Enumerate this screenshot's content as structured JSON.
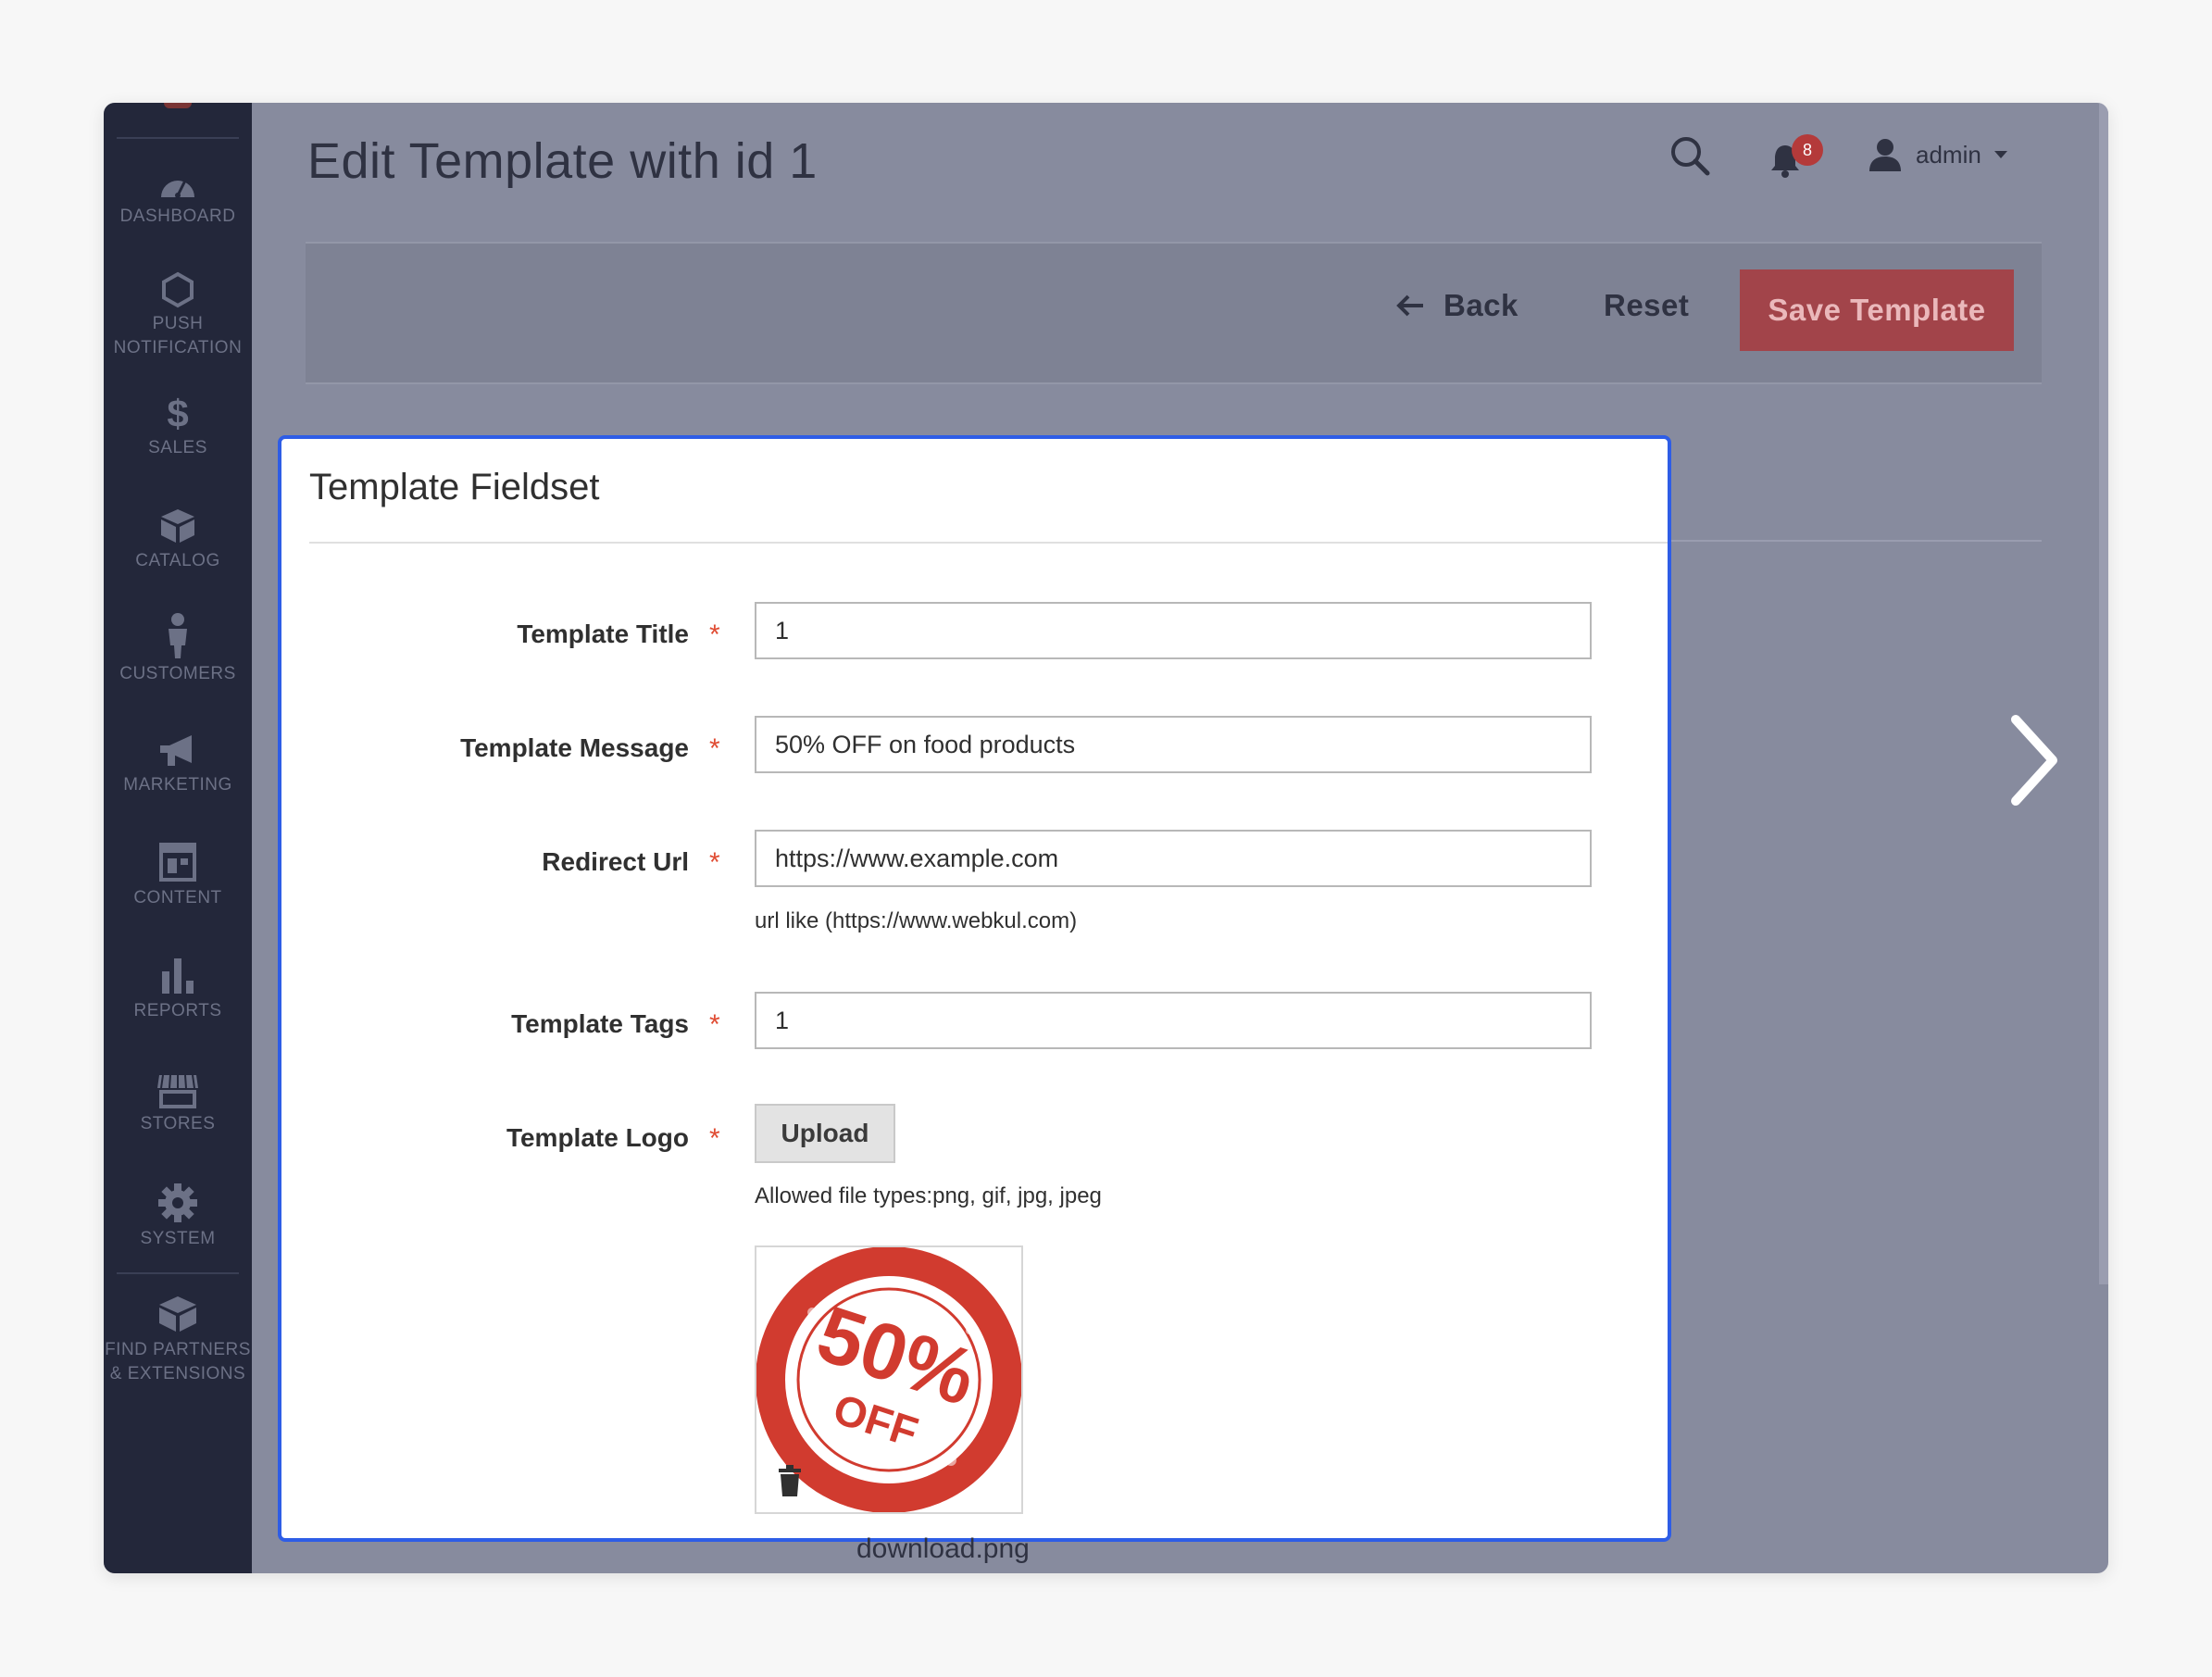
{
  "sidebar": {
    "items": [
      {
        "id": "dashboard",
        "label": "DASHBOARD",
        "icon": "dashboard-icon"
      },
      {
        "id": "push-notification",
        "label": "PUSH\nNOTIFICATION",
        "icon": "hexagon-icon"
      },
      {
        "id": "sales",
        "label": "SALES",
        "icon": "dollar-icon"
      },
      {
        "id": "catalog",
        "label": "CATALOG",
        "icon": "box-icon"
      },
      {
        "id": "customers",
        "label": "CUSTOMERS",
        "icon": "person-icon"
      },
      {
        "id": "marketing",
        "label": "MARKETING",
        "icon": "megaphone-icon"
      },
      {
        "id": "content",
        "label": "CONTENT",
        "icon": "layout-icon"
      },
      {
        "id": "reports",
        "label": "REPORTS",
        "icon": "bar-chart-icon"
      },
      {
        "id": "stores",
        "label": "STORES",
        "icon": "storefront-icon"
      },
      {
        "id": "system",
        "label": "SYSTEM",
        "icon": "gear-icon"
      },
      {
        "id": "find-partners",
        "label": "FIND PARTNERS\n& EXTENSIONS",
        "icon": "cubes-icon"
      }
    ]
  },
  "header": {
    "title": "Edit Template with id 1",
    "notifications_count": "8",
    "user_name": "admin"
  },
  "toolbar": {
    "back_label": "Back",
    "reset_label": "Reset",
    "save_label": "Save Template"
  },
  "form": {
    "title": "Template Fieldset",
    "fields": {
      "title": {
        "label": "Template Title",
        "value": "1"
      },
      "message": {
        "label": "Template Message",
        "value": "50% OFF on food products"
      },
      "url": {
        "label": "Redirect Url",
        "value": "https://www.example.com",
        "note": "url like (https://www.webkul.com)"
      },
      "tags": {
        "label": "Template Tags",
        "value": "1"
      },
      "logo": {
        "label": "Template Logo",
        "upload_label": "Upload",
        "note": "Allowed file types:png, gif, jpg, jpeg",
        "filename": "download.png"
      }
    },
    "required_mark": "*"
  },
  "logo_image": {
    "main_text": "50%",
    "sub_text": "OFF",
    "color": "#d13b2f"
  },
  "colors": {
    "accent_blue": "#2e5de6",
    "save_button": "#a2444a",
    "required": "#e04c33",
    "sidebar": "#23273a"
  }
}
